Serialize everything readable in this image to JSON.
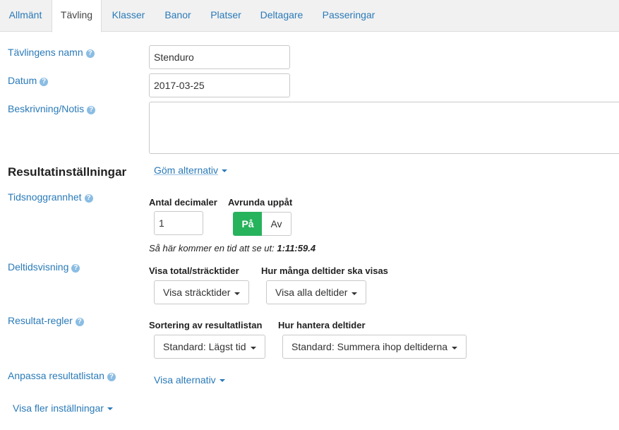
{
  "tabs": [
    {
      "label": "Allmänt"
    },
    {
      "label": "Tävling"
    },
    {
      "label": "Klasser"
    },
    {
      "label": "Banor"
    },
    {
      "label": "Platser"
    },
    {
      "label": "Deltagare"
    },
    {
      "label": "Passeringar"
    }
  ],
  "active_tab": "Tävling",
  "help_glyph": "?",
  "form": {
    "name_label": "Tävlingens namn",
    "name_value": "Stenduro",
    "date_label": "Datum",
    "date_value": "2017-03-25",
    "description_label": "Beskrivning/Notis",
    "description_value": ""
  },
  "results": {
    "title": "Resultatinställningar",
    "hide_options_link": "Göm alternativ",
    "time_precision": {
      "label": "Tidsnoggrannhet",
      "decimals_label": "Antal decimaler",
      "decimals_value": "1",
      "round_up_label": "Avrunda uppåt",
      "round_on": "På",
      "round_off": "Av",
      "example_prefix": "Så här kommer en tid att se ut:",
      "example_value": "1:11:59.4"
    },
    "split_display": {
      "label": "Deltidsvisning",
      "total_label": "Visa total/sträcktider",
      "total_value": "Visa sträcktider",
      "count_label": "Hur många deltider ska visas",
      "count_value": "Visa alla deltider"
    },
    "rules": {
      "label": "Resultat-regler",
      "sort_label": "Sortering av resultatlistan",
      "sort_value": "Standard: Lägst tid",
      "handle_label": "Hur hantera deltider",
      "handle_value": "Standard: Summera ihop deltiderna"
    },
    "customize": {
      "label": "Anpassa resultatlistan",
      "show_options_link": "Visa alternativ"
    }
  },
  "more_settings_link": "Visa fler inställningar",
  "colors": {
    "link": "#2a7ab8",
    "toggle_on": "#27b25c",
    "tab_bar": "#f1f1f1"
  }
}
